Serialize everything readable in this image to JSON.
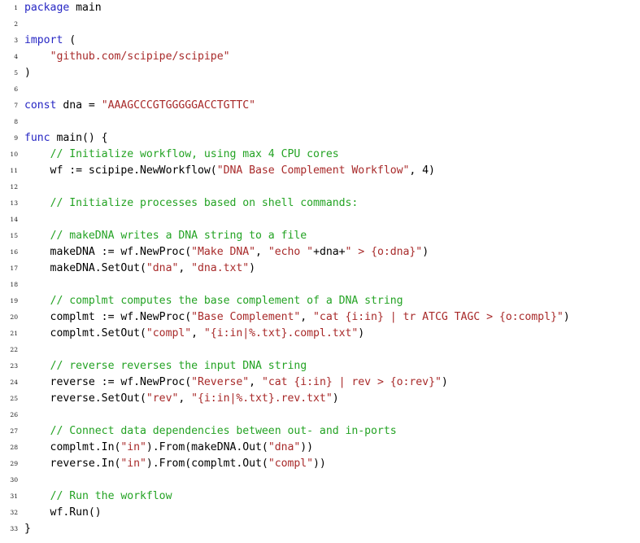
{
  "document": {
    "kind": "source-code-listing",
    "language": "Go",
    "background_color": "#ffffff",
    "colors": {
      "keyword": "#2727c4",
      "string": "#a82a2a",
      "comment": "#24a324",
      "plain": "#000000",
      "line_number": "#1a1a1a"
    },
    "first_line_number": 1,
    "total_lines": 33
  },
  "lines": [
    {
      "n": "1",
      "tokens": [
        {
          "t": "package",
          "c": "kw"
        },
        {
          "t": " main",
          "c": "pln"
        }
      ]
    },
    {
      "n": "2",
      "tokens": []
    },
    {
      "n": "3",
      "tokens": [
        {
          "t": "import",
          "c": "kw"
        },
        {
          "t": " (",
          "c": "pln"
        }
      ]
    },
    {
      "n": "4",
      "tokens": [
        {
          "t": "    ",
          "c": "pln"
        },
        {
          "t": "\"github.com/scipipe/scipipe\"",
          "c": "str"
        }
      ]
    },
    {
      "n": "5",
      "tokens": [
        {
          "t": ")",
          "c": "pln"
        }
      ]
    },
    {
      "n": "6",
      "tokens": []
    },
    {
      "n": "7",
      "tokens": [
        {
          "t": "const",
          "c": "kw"
        },
        {
          "t": " dna = ",
          "c": "pln"
        },
        {
          "t": "\"AAAGCCCGTGGGGGACCTGTTC\"",
          "c": "str"
        }
      ]
    },
    {
      "n": "8",
      "tokens": []
    },
    {
      "n": "9",
      "tokens": [
        {
          "t": "func",
          "c": "kw"
        },
        {
          "t": " main() {",
          "c": "pln"
        }
      ]
    },
    {
      "n": "10",
      "tokens": [
        {
          "t": "    ",
          "c": "pln"
        },
        {
          "t": "// Initialize workflow, using max 4 CPU cores",
          "c": "com"
        }
      ]
    },
    {
      "n": "11",
      "tokens": [
        {
          "t": "    wf := scipipe.NewWorkflow(",
          "c": "pln"
        },
        {
          "t": "\"DNA Base Complement Workflow\"",
          "c": "str"
        },
        {
          "t": ", 4)",
          "c": "pln"
        }
      ]
    },
    {
      "n": "12",
      "tokens": []
    },
    {
      "n": "13",
      "tokens": [
        {
          "t": "    ",
          "c": "pln"
        },
        {
          "t": "// Initialize processes based on shell commands:",
          "c": "com"
        }
      ]
    },
    {
      "n": "14",
      "tokens": []
    },
    {
      "n": "15",
      "tokens": [
        {
          "t": "    ",
          "c": "pln"
        },
        {
          "t": "// makeDNA writes a DNA string to a file",
          "c": "com"
        }
      ]
    },
    {
      "n": "16",
      "tokens": [
        {
          "t": "    makeDNA := wf.NewProc(",
          "c": "pln"
        },
        {
          "t": "\"Make DNA\"",
          "c": "str"
        },
        {
          "t": ", ",
          "c": "pln"
        },
        {
          "t": "\"echo \"",
          "c": "str"
        },
        {
          "t": "+dna+",
          "c": "pln"
        },
        {
          "t": "\" > {o:dna}\"",
          "c": "str"
        },
        {
          "t": ")",
          "c": "pln"
        }
      ]
    },
    {
      "n": "17",
      "tokens": [
        {
          "t": "    makeDNA.SetOut(",
          "c": "pln"
        },
        {
          "t": "\"dna\"",
          "c": "str"
        },
        {
          "t": ", ",
          "c": "pln"
        },
        {
          "t": "\"dna.txt\"",
          "c": "str"
        },
        {
          "t": ")",
          "c": "pln"
        }
      ]
    },
    {
      "n": "18",
      "tokens": []
    },
    {
      "n": "19",
      "tokens": [
        {
          "t": "    ",
          "c": "pln"
        },
        {
          "t": "// complmt computes the base complement of a DNA string",
          "c": "com"
        }
      ]
    },
    {
      "n": "20",
      "tokens": [
        {
          "t": "    complmt := wf.NewProc(",
          "c": "pln"
        },
        {
          "t": "\"Base Complement\"",
          "c": "str"
        },
        {
          "t": ", ",
          "c": "pln"
        },
        {
          "t": "\"cat {i:in} | tr ATCG TAGC > {o:compl}\"",
          "c": "str"
        },
        {
          "t": ")",
          "c": "pln"
        }
      ]
    },
    {
      "n": "21",
      "tokens": [
        {
          "t": "    complmt.SetOut(",
          "c": "pln"
        },
        {
          "t": "\"compl\"",
          "c": "str"
        },
        {
          "t": ", ",
          "c": "pln"
        },
        {
          "t": "\"{i:in|%.txt}.compl.txt\"",
          "c": "str"
        },
        {
          "t": ")",
          "c": "pln"
        }
      ]
    },
    {
      "n": "22",
      "tokens": []
    },
    {
      "n": "23",
      "tokens": [
        {
          "t": "    ",
          "c": "pln"
        },
        {
          "t": "// reverse reverses the input DNA string",
          "c": "com"
        }
      ]
    },
    {
      "n": "24",
      "tokens": [
        {
          "t": "    reverse := wf.NewProc(",
          "c": "pln"
        },
        {
          "t": "\"Reverse\"",
          "c": "str"
        },
        {
          "t": ", ",
          "c": "pln"
        },
        {
          "t": "\"cat {i:in} | rev > {o:rev}\"",
          "c": "str"
        },
        {
          "t": ")",
          "c": "pln"
        }
      ]
    },
    {
      "n": "25",
      "tokens": [
        {
          "t": "    reverse.SetOut(",
          "c": "pln"
        },
        {
          "t": "\"rev\"",
          "c": "str"
        },
        {
          "t": ", ",
          "c": "pln"
        },
        {
          "t": "\"{i:in|%.txt}.rev.txt\"",
          "c": "str"
        },
        {
          "t": ")",
          "c": "pln"
        }
      ]
    },
    {
      "n": "26",
      "tokens": []
    },
    {
      "n": "27",
      "tokens": [
        {
          "t": "    ",
          "c": "pln"
        },
        {
          "t": "// Connect data dependencies between out- and in-ports",
          "c": "com"
        }
      ]
    },
    {
      "n": "28",
      "tokens": [
        {
          "t": "    complmt.In(",
          "c": "pln"
        },
        {
          "t": "\"in\"",
          "c": "str"
        },
        {
          "t": ").From(makeDNA.Out(",
          "c": "pln"
        },
        {
          "t": "\"dna\"",
          "c": "str"
        },
        {
          "t": "))",
          "c": "pln"
        }
      ]
    },
    {
      "n": "29",
      "tokens": [
        {
          "t": "    reverse.In(",
          "c": "pln"
        },
        {
          "t": "\"in\"",
          "c": "str"
        },
        {
          "t": ").From(complmt.Out(",
          "c": "pln"
        },
        {
          "t": "\"compl\"",
          "c": "str"
        },
        {
          "t": "))",
          "c": "pln"
        }
      ]
    },
    {
      "n": "30",
      "tokens": []
    },
    {
      "n": "31",
      "tokens": [
        {
          "t": "    ",
          "c": "pln"
        },
        {
          "t": "// Run the workflow",
          "c": "com"
        }
      ]
    },
    {
      "n": "32",
      "tokens": [
        {
          "t": "    wf.Run()",
          "c": "pln"
        }
      ]
    },
    {
      "n": "33",
      "tokens": [
        {
          "t": "}",
          "c": "pln"
        }
      ]
    }
  ]
}
